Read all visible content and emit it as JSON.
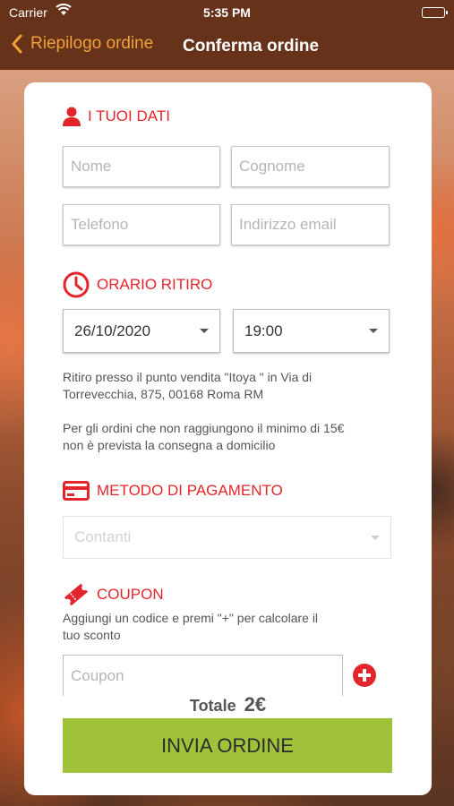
{
  "status_bar": {
    "carrier": "Carrier",
    "time": "5:35 PM"
  },
  "nav": {
    "back_label": "Riepilogo ordine",
    "title": "Conferma ordine"
  },
  "colors": {
    "accent_red": "#e3262c",
    "nav_brown": "#66321a",
    "back_orange": "#f0a23a",
    "submit_green": "#9fc23a"
  },
  "personal": {
    "heading": "I TUOI DATI",
    "icon": "person-icon",
    "nome_placeholder": "Nome",
    "cognome_placeholder": "Cognome",
    "telefono_placeholder": "Telefono",
    "email_placeholder": "Indirizzo email"
  },
  "pickup": {
    "heading": "ORARIO RITIRO",
    "icon": "clock-icon",
    "date": "26/10/2020",
    "time": "19:00",
    "info_line1": "Ritiro presso il punto vendita \"Itoya \" in Via di",
    "info_line2": "Torrevecchia, 875, 00168 Roma RM",
    "min_line1": "Per gli ordini che non raggiungono il minimo di 15€",
    "min_line2": "non è prevista la consegna a domicilio"
  },
  "payment": {
    "heading": "METODO DI PAGAMENTO",
    "icon": "credit-card-icon",
    "selected": "Contanti"
  },
  "coupon": {
    "heading": "COUPON",
    "icon": "ticket-icon",
    "hint_line1": "Aggiungi un codice e premi \"+\" per calcolare il",
    "hint_line2": "tuo sconto",
    "placeholder": "Coupon"
  },
  "footer": {
    "total_label": "Totale",
    "total_value": "2€",
    "submit_label": "INVIA ORDINE"
  }
}
